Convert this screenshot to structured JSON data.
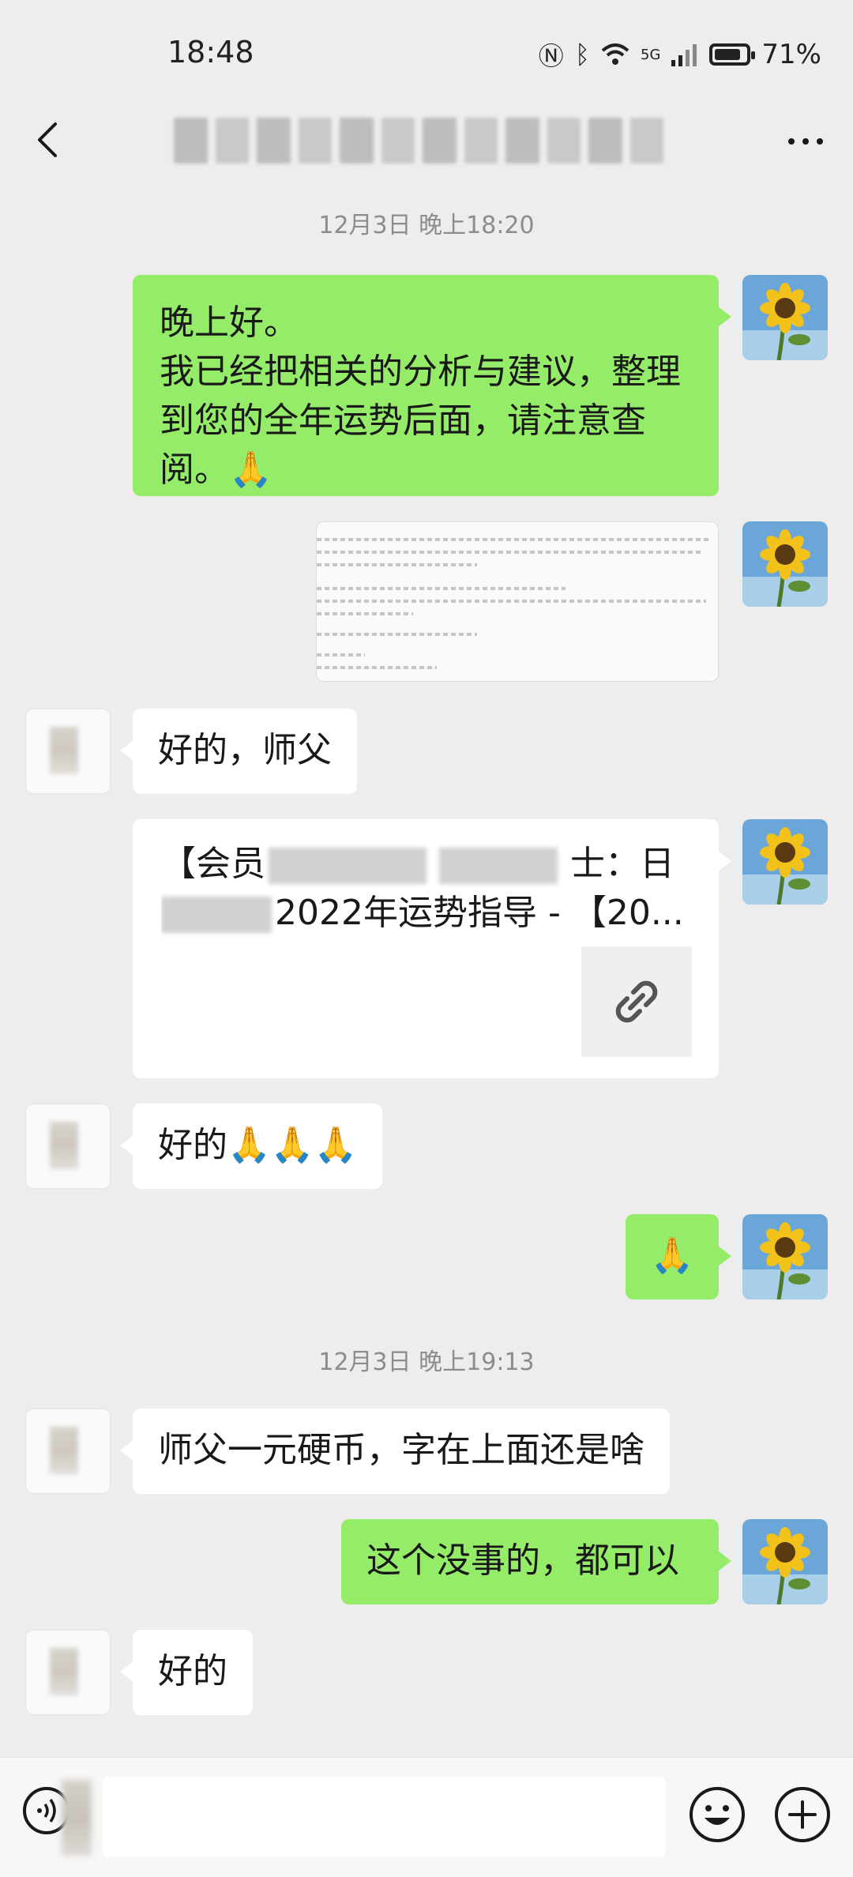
{
  "status": {
    "time": "18:48",
    "network": "5G",
    "battery": "71%",
    "battery_level": 0.71
  },
  "nav": {
    "title": ""
  },
  "messages": {
    "ts1": "12月3日 晚上18:20",
    "m1_l1": "晚上好。",
    "m1_l2": "我已经把相关的分析与建议，整理",
    "m1_l3": "到您的全年运势后面，请注意查",
    "m1_l4": "阅。🙏",
    "m2": "好的，师父",
    "link_l1a": "【会员",
    "link_l1b": "士：日",
    "link_l2": "2022年运势指导 - 【20...",
    "m3": "好的🙏🙏🙏",
    "m4": "🙏",
    "ts2": "12月3日 晚上19:13",
    "m5": "师父一元硬币，字在上面还是啥",
    "m6": "这个没事的，都可以",
    "m7": "好的"
  },
  "input": {
    "value": ""
  },
  "colors": {
    "self_bubble": "#95ec69",
    "other_bubble": "#ffffff",
    "background": "#ededed"
  },
  "icons": [
    "back-icon",
    "more-icon",
    "voice-icon",
    "emoji-icon",
    "plus-icon",
    "link-icon"
  ]
}
